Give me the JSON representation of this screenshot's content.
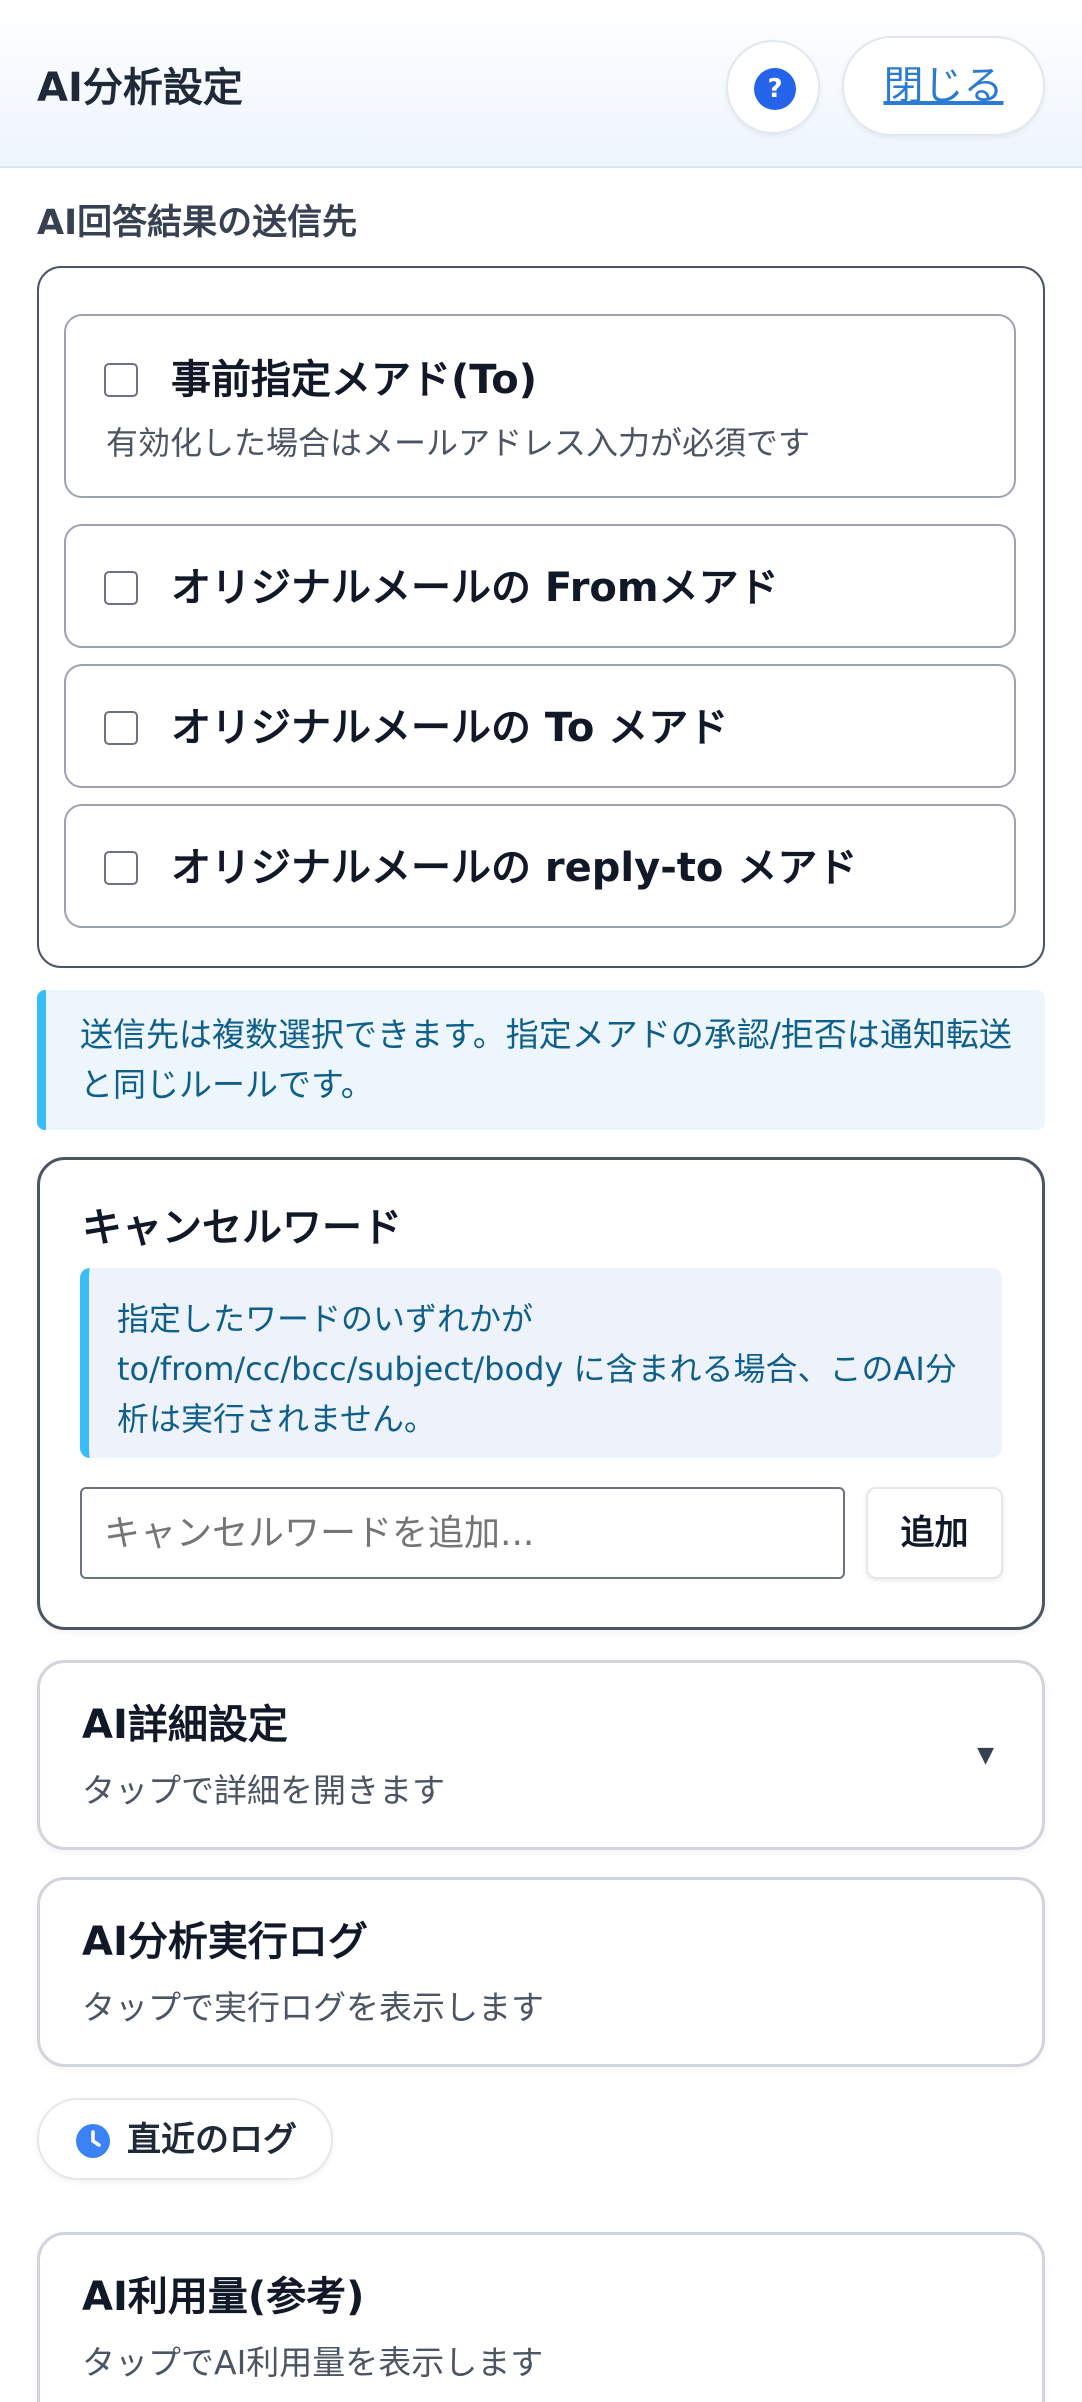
{
  "header": {
    "title": "AI分析設定",
    "help_icon": "question-circle-icon",
    "help_label": "?",
    "close_label": "閉じる"
  },
  "destinations": {
    "section_label": "AI回答結果の送信先",
    "options": [
      {
        "label": "事前指定メアド(To)",
        "sublabel": "有効化した場合はメールアドレス入力が必須です",
        "checked": false
      },
      {
        "label": "オリジナルメールの Fromメアド",
        "checked": false
      },
      {
        "label": "オリジナルメールの To メアド",
        "checked": false
      },
      {
        "label": "オリジナルメールの reply-to メアド",
        "checked": false
      }
    ],
    "note": "送信先は複数選択できます。指定メアドの承認/拒否は通知転送と同じルールです。"
  },
  "cancel_words": {
    "title": "キャンセルワード",
    "info": "指定したワードのいずれかが to/from/cc/bcc/subject/body に含まれる場合、このAI分析は実行されません。",
    "input_placeholder": "キャンセルワードを追加...",
    "input_value": "",
    "add_label": "追加"
  },
  "ai_details": {
    "title": "AI詳細設定",
    "subtitle": "タップで詳細を開きます",
    "expand_icon": "caret-down-icon"
  },
  "exec_log": {
    "title": "AI分析実行ログ",
    "subtitle": "タップで実行ログを表示します"
  },
  "recent_logs": {
    "icon": "clock-icon",
    "label": "直近のログ"
  },
  "usage": {
    "title": "AI利用量(参考)",
    "subtitle": "タップでAI利用量を表示します"
  },
  "colors": {
    "accent": "#2563eb",
    "link": "#2b7bd4",
    "info_border": "#38bdf8",
    "info_text": "#0f5f8a"
  }
}
